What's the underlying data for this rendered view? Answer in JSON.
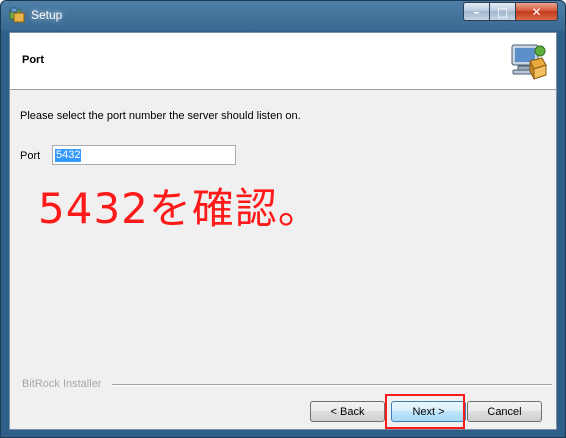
{
  "window": {
    "title": "Setup",
    "controls": {
      "minimize": "–",
      "maximize": "□",
      "close": "✕"
    }
  },
  "header": {
    "title": "Port",
    "icon": "computer-package-icon"
  },
  "body": {
    "instruction": "Please select the port number the server should listen on.",
    "port_label": "Port",
    "port_value": "5432",
    "annotation": "5432を確認。"
  },
  "footer": {
    "brand": "BitRock Installer",
    "back_label": "< Back",
    "next_label": "Next >",
    "cancel_label": "Cancel"
  },
  "colors": {
    "annotation": "#ff1a1a",
    "selection": "#3399ff",
    "titlebar": "#3a6b93"
  }
}
